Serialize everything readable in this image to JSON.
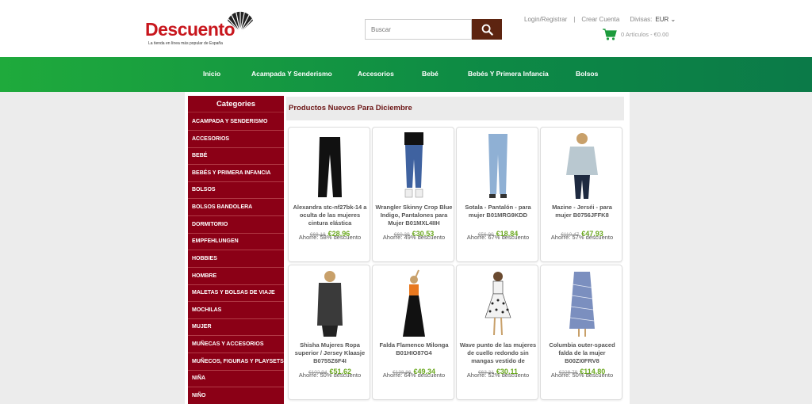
{
  "header": {
    "logo_text": "Descuento",
    "logo_tagline": "La tienda en línea más popular de España",
    "search_placeholder": "Buscar",
    "login_link": "Login/Registrar",
    "separator": "|",
    "create_account": "Crear Cuenta",
    "currency_label": "Divisas:",
    "currency_value": "EUR",
    "cart_text": "0  Artículos  -  €0.00"
  },
  "nav": {
    "items": [
      "Inicio",
      "Acampada Y Senderismo",
      "Accesorios",
      "Bebé",
      "Bebés Y Primera Infancia",
      "Bolsos"
    ]
  },
  "sidebar": {
    "title": "Categories",
    "items": [
      "Acampada y senderismo",
      "Accesorios",
      "Bebé",
      "Bebés y primera infancia",
      "Bolsos",
      "Bolsos Bandolera",
      "Dormitorio",
      "Empfehlungen",
      "Hobbies",
      "Hombre",
      "Maletas y bolsas de viaje",
      "Mochilas",
      "Mujer",
      "Muñecas y accesorios",
      "Muñecos, figuras y playsets",
      "Niña",
      "Niño"
    ]
  },
  "section": {
    "title": "Productos Nuevos Para Diciembre"
  },
  "products": [
    {
      "name": "Alexandra stc-nf27bk-14 a oculta de las mujeres cintura elástica",
      "old_price": "€68.18",
      "new_price": "€28.96",
      "saving": "Ahorre: 58% descuento"
    },
    {
      "name": "Wrangler Skinny Crop Blue Indigo, Pantalones para Mujer B01MXL4IIH",
      "old_price": "€60.39",
      "new_price": "€30.53",
      "saving": "Ahorre: 49% descuento"
    },
    {
      "name": "Sotala - Pantalón - para mujer B01MRG9KDD",
      "old_price": "€56.90",
      "new_price": "€18.84",
      "saving": "Ahorre: 67% descuento"
    },
    {
      "name": "Mazine - Jerséi - para mujer B0756JFFK8",
      "old_price": "€110.47",
      "new_price": "€47.93",
      "saving": "Ahorre: 57% descuento"
    },
    {
      "name": "Shisha Mujeres Ropa superior / Jersey Klaasje B0755Z6F4I",
      "old_price": "€102.94",
      "new_price": "€51.62",
      "saving": "Ahorre: 50% descuento"
    },
    {
      "name": "Falda Flamenco Milonga B01HIO87G4",
      "old_price": "€138.86",
      "new_price": "€49.34",
      "saving": "Ahorre: 64% descuento"
    },
    {
      "name": "Wave punto de las mujeres de cuello redondo sin mangas vestido de",
      "old_price": "€63.31",
      "new_price": "€30.11",
      "saving": "Ahorre: 52% descuento"
    },
    {
      "name": "Columbia outer-spaced falda de la mujer B00ZI0FRV8",
      "old_price": "€228.79",
      "new_price": "€114.80",
      "saving": "Ahorre: 50% descuento"
    }
  ],
  "colors": {
    "brand_red": "#c8161d",
    "sidebar_bg": "#8b0016",
    "nav_green": "#1faa3c",
    "price_green": "#6aa81e",
    "search_button": "#5d2410"
  },
  "icons": {
    "search": "search-icon",
    "cart": "cart-icon",
    "logo_shell": "shell-logo-icon"
  }
}
